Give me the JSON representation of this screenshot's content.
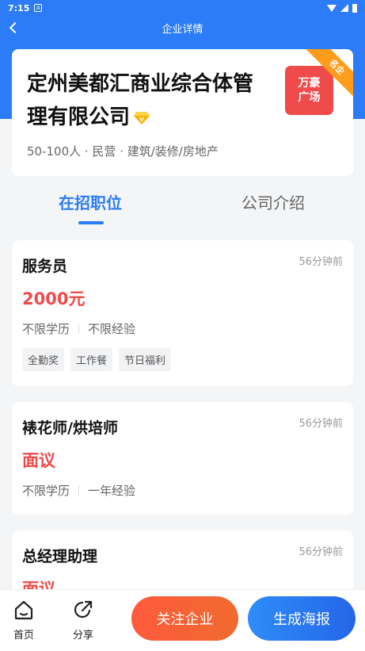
{
  "status": {
    "time": "7:15"
  },
  "nav": {
    "title": "企业详情"
  },
  "company": {
    "name": "定州美都汇商业综合体管理有限公司",
    "meta": "50-100人 · 民营 · 建筑/装修/房地产",
    "logo_line1": "万豪",
    "logo_line2": "广场",
    "ribbon": "名企"
  },
  "tabs": [
    {
      "label": "在招职位",
      "active": true
    },
    {
      "label": "公司介绍",
      "active": false
    }
  ],
  "jobs": [
    {
      "title": "服务员",
      "time": "56分钟前",
      "salary": "2000元",
      "education": "不限学历",
      "experience": "不限经验",
      "tags": [
        "全勤奖",
        "工作餐",
        "节日福利"
      ]
    },
    {
      "title": "裱花师/烘培师",
      "time": "56分钟前",
      "salary": "面议",
      "education": "不限学历",
      "experience": "一年经验",
      "tags": []
    },
    {
      "title": "总经理助理",
      "time": "56分钟前",
      "salary": "面议",
      "education": "",
      "experience": "",
      "tags": []
    }
  ],
  "bottom": {
    "home": "首页",
    "share": "分享",
    "follow": "关注企业",
    "poster": "生成海报"
  },
  "colors": {
    "primary": "#2b7cf6",
    "salary": "#ef4a4a",
    "follow": "#ff5a3c",
    "ribbon": "#ff9c1a"
  }
}
